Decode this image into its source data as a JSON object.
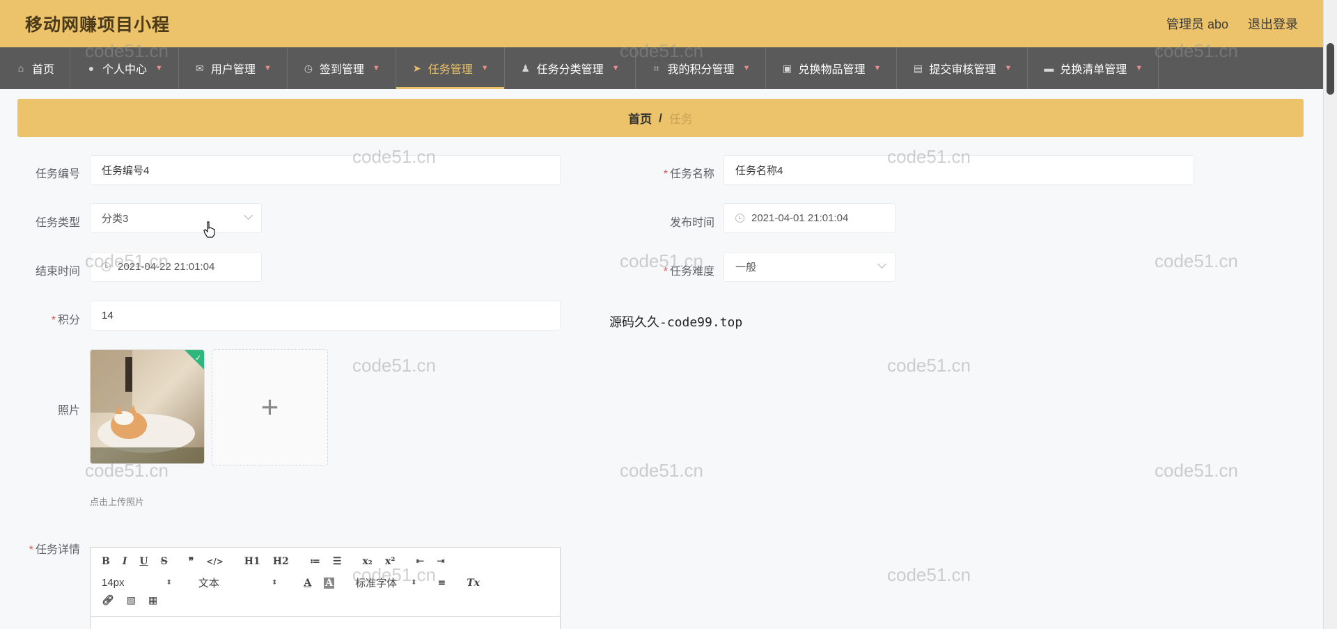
{
  "header": {
    "title": "移动网赚项目小程",
    "user_label": "管理员 abo",
    "logout_label": "退出登录"
  },
  "nav": {
    "items": [
      {
        "label": "首页",
        "icon": "home-icon",
        "has_caret": false
      },
      {
        "label": "个人中心",
        "icon": "user-icon",
        "has_caret": true
      },
      {
        "label": "用户管理",
        "icon": "mail-icon",
        "has_caret": true
      },
      {
        "label": "签到管理",
        "icon": "compass-icon",
        "has_caret": true
      },
      {
        "label": "任务管理",
        "icon": "send-icon",
        "has_caret": true,
        "active": true
      },
      {
        "label": "任务分类管理",
        "icon": "person-icon",
        "has_caret": true
      },
      {
        "label": "我的积分管理",
        "icon": "crop-icon",
        "has_caret": true
      },
      {
        "label": "兑换物品管理",
        "icon": "briefcase-icon",
        "has_caret": true
      },
      {
        "label": "提交审核管理",
        "icon": "clipboard-icon",
        "has_caret": true
      },
      {
        "label": "兑换清单管理",
        "icon": "monitor-icon",
        "has_caret": true
      }
    ]
  },
  "breadcrumb": {
    "home": "首页",
    "separator": "/",
    "current": "任务"
  },
  "form": {
    "task_no": {
      "label": "任务编号",
      "value": "任务编号4"
    },
    "task_name": {
      "label": "任务名称",
      "value": "任务名称4",
      "required": true
    },
    "task_type": {
      "label": "任务类型",
      "value": "分类3"
    },
    "publish_time": {
      "label": "发布时间",
      "value": "2021-04-01 21:01:04"
    },
    "end_time": {
      "label": "结束时间",
      "value": "2021-04-22 21:01:04"
    },
    "difficulty": {
      "label": "任务难度",
      "value": "一般",
      "required": true
    },
    "points": {
      "label": "积分",
      "value": "14",
      "required": true
    },
    "photo": {
      "label": "照片",
      "upload_hint": "点击上传照片",
      "plus": "+"
    },
    "details": {
      "label": "任务详情",
      "required": true
    }
  },
  "editor": {
    "font_size": "14px",
    "paragraph": "文本",
    "font_family": "标准字体",
    "buttons_row1": [
      "B",
      "I",
      "U",
      "S",
      "❞",
      "</>",
      "H1",
      "H2",
      "≔",
      "☰",
      "x₂",
      "x²",
      "⇤",
      "⇥"
    ],
    "text_color_glyph": "A",
    "bg_color_glyph": "A",
    "align_glyph": "≡",
    "clear_glyph": "Tx"
  },
  "source_text": "源码久久-code99.top",
  "watermark": "code51.cn",
  "colors": {
    "accent": "#ecc36a",
    "nav_bg": "#5a5a5a",
    "required": "#e05252"
  }
}
